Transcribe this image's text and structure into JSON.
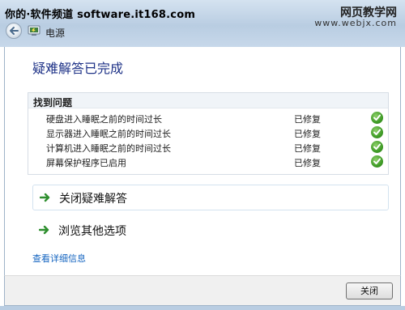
{
  "watermark": {
    "left": "你的·软件频道 software.it168.com",
    "right_top": "网页教学网",
    "right_bottom": "www.webjx.com"
  },
  "window": {
    "title": "电源"
  },
  "heading": "疑难解答已完成",
  "issues": {
    "title": "找到问题",
    "items": [
      {
        "description": "硬盘进入睡眠之前的时间过长",
        "status": "已修复"
      },
      {
        "description": "显示器进入睡眠之前的时间过长",
        "status": "已修复"
      },
      {
        "description": "计算机进入睡眠之前的时间过长",
        "status": "已修复"
      },
      {
        "description": "屏幕保护程序已启用",
        "status": "已修复"
      }
    ]
  },
  "options": {
    "close_troubleshooting": "关闭疑难解答",
    "browse_other": "浏览其他选项"
  },
  "details_link": "查看详细信息",
  "footer": {
    "close_label": "关闭"
  },
  "icons": {
    "back": "back-arrow-icon",
    "app": "power-options-icon",
    "fixed": "green-check-icon",
    "option_arrow": "green-arrow-icon"
  },
  "colors": {
    "heading": "#1e3287",
    "link": "#1565c0",
    "check": "#3e9b26",
    "frame": "#b9cde2"
  }
}
